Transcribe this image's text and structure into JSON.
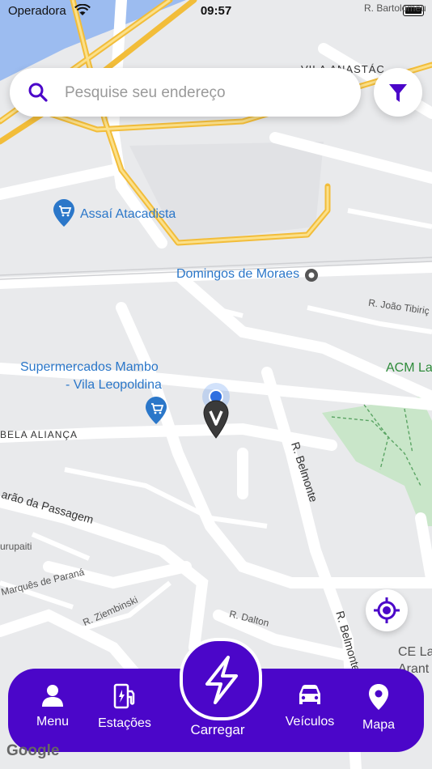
{
  "status_bar": {
    "carrier": "Operadora",
    "time": "09:57"
  },
  "search": {
    "placeholder": "Pesquise seu endereço"
  },
  "map": {
    "places": {
      "assai": "Assaí Atacadista",
      "domingos": "Domingos de Moraes",
      "mambo_line1": "Supermercados Mambo",
      "mambo_line2": "- Vila Leopoldina",
      "acm": "ACM La",
      "ce_line1": "CE La",
      "ce_line2": "Arant"
    },
    "streets": {
      "bartolomeu": "R. Bartolomeu",
      "vila_anastacio": "VILA ANASTÁC",
      "joao_tibirica": "R. João Tibiriç",
      "bela_alianca": "BELA ALIANÇA",
      "belmonte_1": "R. Belmonte",
      "barao_passagem": "arão da Passagem",
      "curupaiti": "urupaiti",
      "marques_parana": "Marquês de Paraná",
      "ziembinski": "R. Ziembinski",
      "dalton": "R. Dalton",
      "belmonte_2": "R. Belmonte"
    },
    "attribution": "Google"
  },
  "nav": {
    "menu": "Menu",
    "stations": "Estações",
    "charge": "Carregar",
    "vehicles": "Veículos",
    "map": "Mapa"
  },
  "colors": {
    "brand": "#4b06c9",
    "highway": "#f6c544",
    "park": "#c9e6c9",
    "place_blue": "#2b77c9"
  },
  "icons": {
    "search": "search-icon",
    "filter": "filter-icon",
    "locate": "locate-icon",
    "menu": "user-icon",
    "stations": "fuel-charger-icon",
    "charge": "lightning-icon",
    "vehicles": "car-icon",
    "map": "map-pin-icon"
  }
}
